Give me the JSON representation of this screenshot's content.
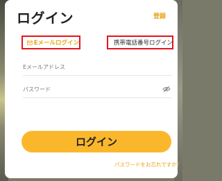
{
  "header": {
    "title": "ログイン",
    "register_label": "登録"
  },
  "tabs": {
    "email_label": "Eメールログイン",
    "phone_label": "携帯電話番号ログイン",
    "email_icon": "mail-icon",
    "phone_icon": "phone-icon"
  },
  "form": {
    "email_placeholder": "Eメールアドレス",
    "email_value": "",
    "password_placeholder": "パスワード",
    "password_value": "",
    "password_toggle_icon": "eye-off-icon"
  },
  "actions": {
    "login_label": "ログイン",
    "forgot_label": "パスワードをお忘れですか？"
  },
  "colors": {
    "accent": "#fbb72c",
    "link": "#e8a317",
    "highlight_border": "#e5141c"
  }
}
